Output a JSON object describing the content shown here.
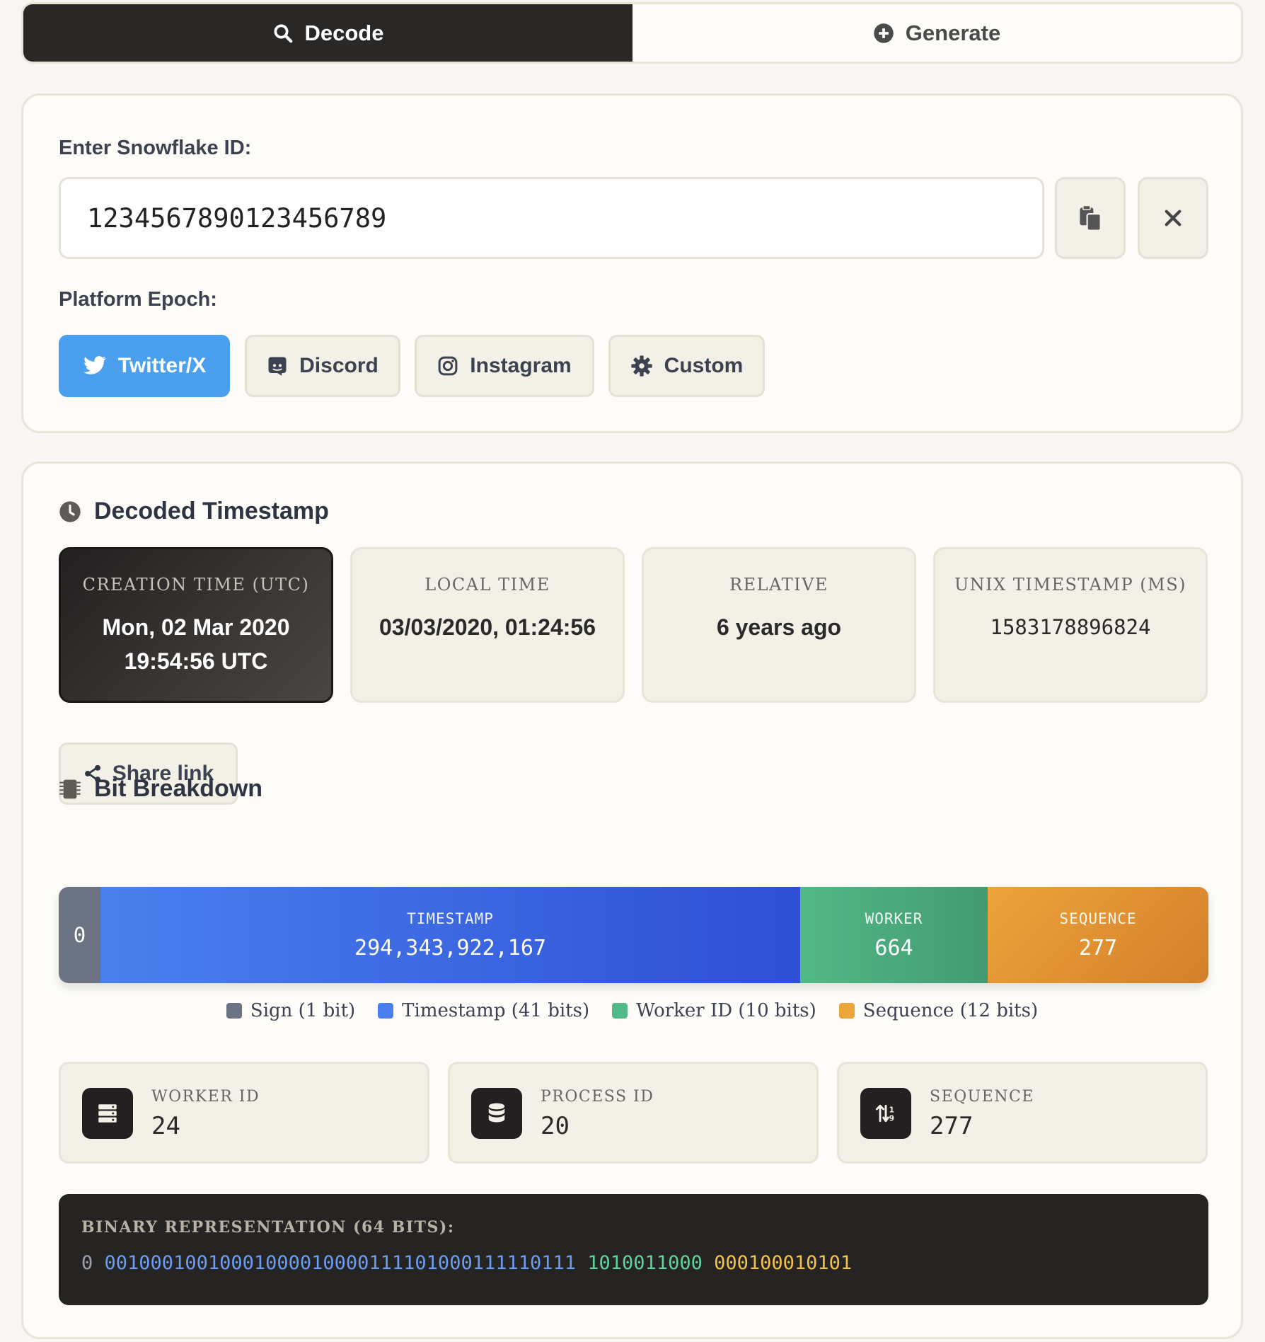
{
  "tabs": {
    "decode": "Decode",
    "generate": "Generate"
  },
  "input": {
    "label": "Enter Snowflake ID:",
    "value": "1234567890123456789",
    "paste_icon": "clipboard-icon",
    "clear_icon": "close-icon"
  },
  "epoch": {
    "label": "Platform Epoch:",
    "options": [
      {
        "label": "Twitter/X",
        "icon": "twitter-icon",
        "active": true
      },
      {
        "label": "Discord",
        "icon": "discord-icon",
        "active": false
      },
      {
        "label": "Instagram",
        "icon": "instagram-icon",
        "active": false
      },
      {
        "label": "Custom",
        "icon": "gear-icon",
        "active": false
      }
    ]
  },
  "decoded": {
    "title": "Decoded Timestamp",
    "cards": [
      {
        "label": "CREATION TIME (UTC)",
        "value": "Mon, 02 Mar 2020 19:54:56 UTC"
      },
      {
        "label": "LOCAL TIME",
        "value": "03/03/2020, 01:24:56"
      },
      {
        "label": "RELATIVE",
        "value": "6 years ago"
      },
      {
        "label": "UNIX TIMESTAMP (MS)",
        "value": "1583178896824"
      }
    ],
    "share_label": "Share link"
  },
  "bits": {
    "title": "Bit Breakdown",
    "sign": "0",
    "timestamp": {
      "label": "TIMESTAMP",
      "value": "294,343,922,167"
    },
    "worker": {
      "label": "WORKER",
      "value": "664"
    },
    "sequence": {
      "label": "SEQUENCE",
      "value": "277"
    },
    "legend": [
      {
        "label": "Sign (1 bit)",
        "color": "#6c7383"
      },
      {
        "label": "Timestamp (41 bits)",
        "color": "#4a80ee"
      },
      {
        "label": "Worker ID (10 bits)",
        "color": "#52b887"
      },
      {
        "label": "Sequence (12 bits)",
        "color": "#eda43a"
      }
    ]
  },
  "stats": [
    {
      "label": "WORKER ID",
      "value": "24",
      "icon": "server-icon"
    },
    {
      "label": "PROCESS ID",
      "value": "20",
      "icon": "database-icon"
    },
    {
      "label": "SEQUENCE",
      "value": "277",
      "icon": "sort-icon"
    }
  ],
  "binary": {
    "label": "BINARY REPRESENTATION (64 BITS):",
    "sign": "0",
    "timestamp": "00100010010001000010000111101000111110111",
    "worker": "1010011000",
    "sequence": "000100010101"
  },
  "colors": {
    "accent_active": "#4aa0ee",
    "dark": "#2a2826",
    "sign": "#6c7383",
    "timestamp": "#4a80ee",
    "worker": "#52b887",
    "sequence": "#eda43a"
  }
}
